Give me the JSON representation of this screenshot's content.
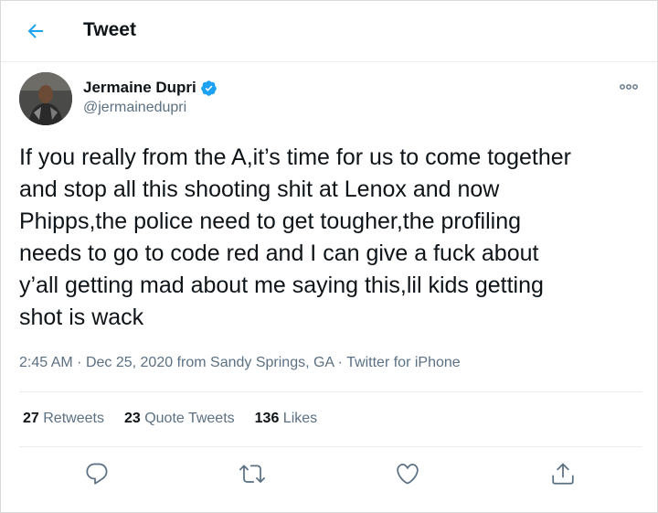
{
  "header": {
    "title": "Tweet",
    "back_icon": "arrow-left-icon"
  },
  "author": {
    "display_name": "Jermaine Dupri",
    "handle": "@jermainedupri",
    "verified_icon": "verified-badge-icon"
  },
  "tweet": {
    "text": "If you really from the A,it’s time for us to come together\nand stop all this shooting shit at Lenox and now\nPhipps,the police need to get tougher,the profiling\nneeds to go to code red and I can give a fuck about\ny’all getting mad about me saying this,lil kids getting\nshot is wack",
    "time": "2:45 AM",
    "date": "Dec 25, 2020",
    "location": "from Sandy Springs, GA",
    "client": "Twitter for iPhone",
    "separator": "·"
  },
  "stats": {
    "retweets_count": "27",
    "retweets_label": "Retweets",
    "quotes_count": "23",
    "quotes_label": "Quote Tweets",
    "likes_count": "136",
    "likes_label": "Likes"
  },
  "actions": [
    "reply-icon",
    "retweet-icon",
    "like-icon",
    "share-icon"
  ],
  "colors": {
    "accent": "#1da1f2",
    "text": "#0f1419",
    "muted": "#5b7083",
    "border": "#ebeef0"
  }
}
